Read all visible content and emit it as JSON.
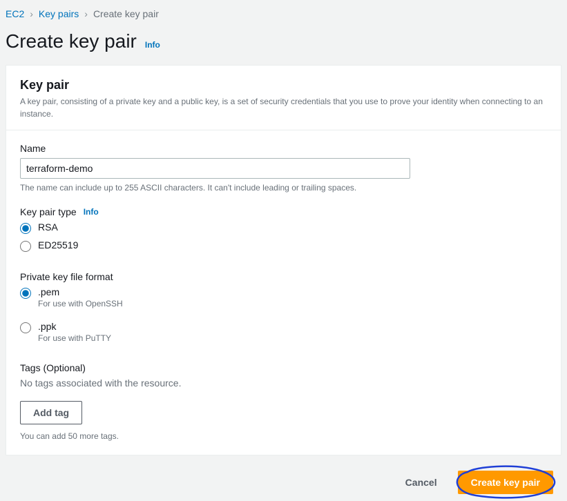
{
  "breadcrumb": {
    "items": [
      {
        "label": "EC2"
      },
      {
        "label": "Key pairs"
      }
    ],
    "current": "Create key pair"
  },
  "page": {
    "title": "Create key pair",
    "info": "Info"
  },
  "panel": {
    "title": "Key pair",
    "description": "A key pair, consisting of a private key and a public key, is a set of security credentials that you use to prove your identity when connecting to an instance."
  },
  "name_field": {
    "label": "Name",
    "value": "terraform-demo",
    "hint": "The name can include up to 255 ASCII characters. It can't include leading or trailing spaces."
  },
  "type_field": {
    "label": "Key pair type",
    "info": "Info",
    "options": [
      {
        "label": "RSA",
        "selected": true
      },
      {
        "label": "ED25519",
        "selected": false
      }
    ]
  },
  "format_field": {
    "label": "Private key file format",
    "options": [
      {
        "label": ".pem",
        "sub": "For use with OpenSSH",
        "selected": true
      },
      {
        "label": ".ppk",
        "sub": "For use with PuTTY",
        "selected": false
      }
    ]
  },
  "tags": {
    "label": "Tags (Optional)",
    "empty": "No tags associated with the resource.",
    "add_btn": "Add tag",
    "hint": "You can add 50 more tags."
  },
  "footer": {
    "cancel": "Cancel",
    "create": "Create key pair"
  }
}
